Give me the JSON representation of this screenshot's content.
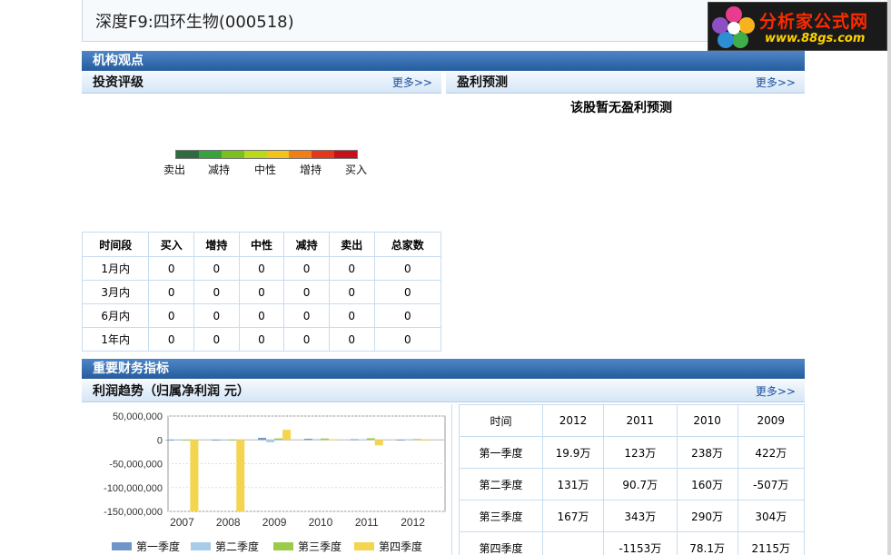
{
  "header": {
    "title": "深度F9:四环生物(000518)"
  },
  "logo": {
    "name": "分析家公式网",
    "url_text": "www.88gs.com"
  },
  "section1": {
    "title": "机构观点",
    "rating": {
      "title": "投资评级",
      "more": "更多>>",
      "scale_colors": [
        "#2e6b3f",
        "#38a33a",
        "#79c21c",
        "#bcd81a",
        "#f2c31a",
        "#f27f14",
        "#e8361c",
        "#c8101c"
      ],
      "scale_labels": [
        "卖出",
        "减持",
        "中性",
        "增持",
        "买入"
      ],
      "table": {
        "headers": [
          "时间段",
          "买入",
          "增持",
          "中性",
          "减持",
          "卖出",
          "总家数"
        ],
        "rows": [
          [
            "1月内",
            "0",
            "0",
            "0",
            "0",
            "0",
            "0"
          ],
          [
            "3月内",
            "0",
            "0",
            "0",
            "0",
            "0",
            "0"
          ],
          [
            "6月内",
            "0",
            "0",
            "0",
            "0",
            "0",
            "0"
          ],
          [
            "1年内",
            "0",
            "0",
            "0",
            "0",
            "0",
            "0"
          ]
        ]
      }
    },
    "forecast": {
      "title": "盈利预测",
      "more": "更多>>",
      "message": "该股暂无盈利预测"
    }
  },
  "section2": {
    "title": "重要财务指标",
    "profit": {
      "title": "利润趋势（归属净利润 元）",
      "more": "更多>>"
    },
    "table": {
      "headers": [
        "时间",
        "2012",
        "2011",
        "2010",
        "2009"
      ],
      "rows": [
        [
          "第一季度",
          "19.9万",
          "123万",
          "238万",
          "422万"
        ],
        [
          "第二季度",
          "131万",
          "90.7万",
          "160万",
          "-507万"
        ],
        [
          "第三季度",
          "167万",
          "343万",
          "290万",
          "304万"
        ],
        [
          "第四季度",
          "",
          "-1153万",
          "78.1万",
          "2115万"
        ]
      ]
    }
  },
  "chart_data": {
    "type": "bar",
    "title": "利润趋势（归属净利润 元）",
    "categories": [
      "2007",
      "2008",
      "2009",
      "2010",
      "2011",
      "2012"
    ],
    "ylim": [
      -150000000,
      50000000
    ],
    "yticks": [
      "50,000,000",
      "0",
      "-50,000,000",
      "-100,000,000",
      "-150,000,000"
    ],
    "ytick_values": [
      50000000,
      0,
      -50000000,
      -100000000,
      -150000000
    ],
    "series": [
      {
        "name": "第一季度",
        "color": "#7096c9",
        "values": [
          0,
          0,
          4220000,
          2380000,
          1230000,
          199000
        ]
      },
      {
        "name": "第二季度",
        "color": "#a8cbe8",
        "values": [
          0,
          0,
          -5070000,
          1600000,
          907000,
          1310000
        ]
      },
      {
        "name": "第三季度",
        "color": "#9ccb4a",
        "values": [
          0,
          0,
          3040000,
          2900000,
          3430000,
          1670000
        ]
      },
      {
        "name": "第四季度",
        "color": "#f3d550",
        "values": [
          -150000000,
          -150000000,
          21150000,
          781000,
          -11530000,
          0
        ]
      }
    ],
    "legend": "bottom",
    "grid": true
  }
}
